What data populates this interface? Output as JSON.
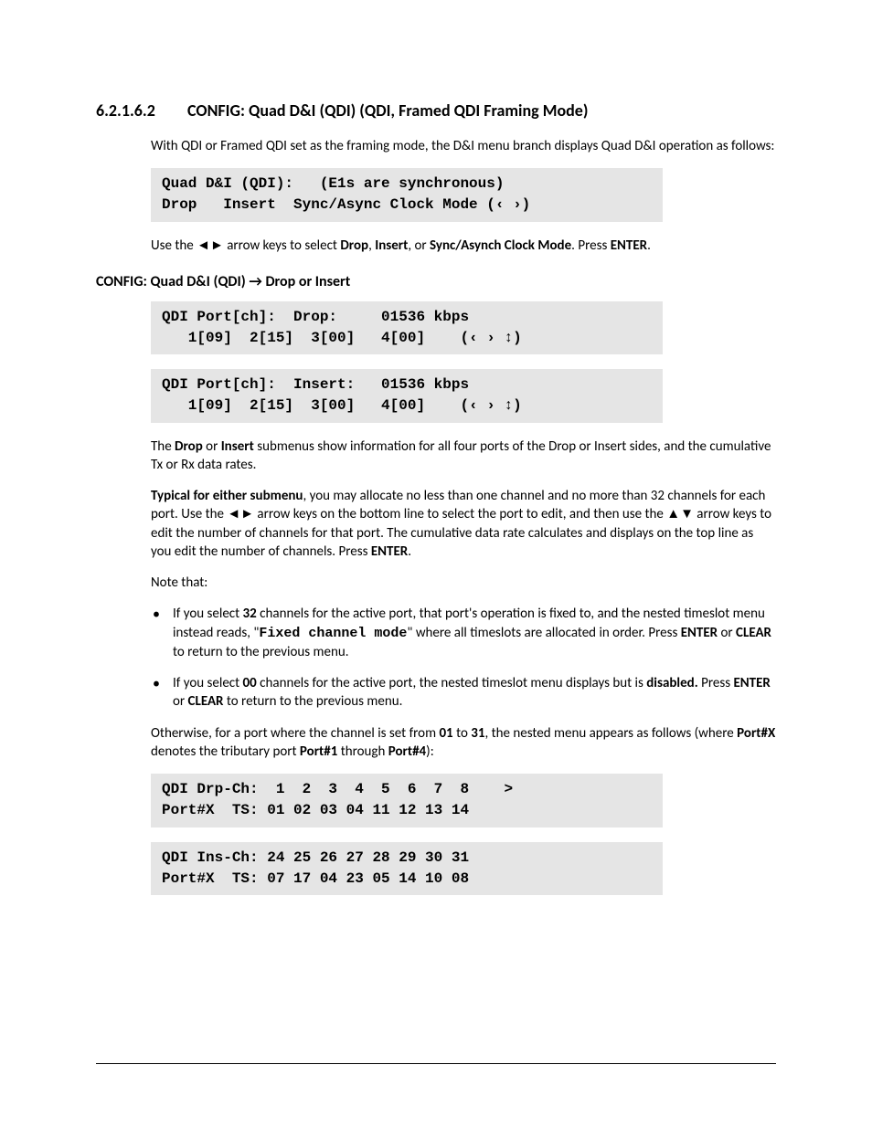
{
  "section": {
    "number": "6.2.1.6.2",
    "title": "CONFIG: Quad D&I (QDI) (QDI, Framed QDI Framing Mode)"
  },
  "paragraphs": {
    "intro": "With QDI or Framed QDI set as the framing mode, the D&I menu branch displays Quad D&I operation as follows:",
    "use_arrows_pre": "Use the ◄► arrow keys to select ",
    "use_arrows_b1": "Drop",
    "use_arrows_mid1": ", ",
    "use_arrows_b2": "Insert",
    "use_arrows_mid2": ", or ",
    "use_arrows_b3": "Sync/Asynch Clock Mode",
    "use_arrows_mid3": ". Press ",
    "use_arrows_b4": "ENTER",
    "use_arrows_end": ".",
    "sub_heading": "CONFIG: Quad D&I (QDI) → Drop or Insert",
    "sub_para_pre": "The ",
    "sub_para_b1": "Drop",
    "sub_para_mid1": " or ",
    "sub_para_b2": "Insert",
    "sub_para_rest": " submenus show information for all four ports of the Drop or Insert sides, and the cumulative Tx or Rx data rates.",
    "typical_b": "Typical for either submenu",
    "typical_rest": ", you may allocate no less than one channel and no more than 32 channels for each port. Use the ◄► arrow keys on the bottom line to select the port to edit, and then use the ▲▼ arrow keys to edit the number of channels for that port. The cumulative data rate calculates and displays on the top line as you edit the number of channels. Press ",
    "typical_b2": "ENTER",
    "typical_end": ".",
    "note_that": "Note that:",
    "bullet1_a": "If you select ",
    "bullet1_b1": "32",
    "bullet1_b": " channels for the active port, that port's operation is fixed to, and the nested timeslot menu instead reads, \"",
    "bullet1_mono": "Fixed channel mode",
    "bullet1_c": "\" where all timeslots are allocated in order. Press ",
    "bullet1_b2": "ENTER",
    "bullet1_d": " or ",
    "bullet1_b3": "CLEAR",
    "bullet1_e": " to return to the previous menu.",
    "bullet2_a": "If you select ",
    "bullet2_b1": "00",
    "bullet2_b": " channels for the active port, the nested timeslot menu displays but is ",
    "bullet2_b2": "disabled.",
    "bullet2_c": " Press ",
    "bullet2_b3": "ENTER",
    "bullet2_d": " or ",
    "bullet2_b4": "CLEAR",
    "bullet2_e": " to return to the previous menu.",
    "otherwise_a": "Otherwise, for a port where the channel is set from ",
    "otherwise_b1": "01",
    "otherwise_b": " to ",
    "otherwise_b2": "31",
    "otherwise_c": ", the nested menu appears as follows (where ",
    "otherwise_b3": "Port#X",
    "otherwise_d": " denotes the tributary port ",
    "otherwise_b4": "Port#1",
    "otherwise_e": " through ",
    "otherwise_b5": "Port#4",
    "otherwise_f": "):"
  },
  "lcd": {
    "screen1_l1": "Quad D&I (QDI):   (E1s are synchronous)",
    "screen1_l2": "Drop   Insert  Sync/Async Clock Mode (‹ ›)",
    "screen2_l1": "QDI Port[ch]:  Drop:     01536 kbps",
    "screen2_l2": "   1[09]  2[15]  3[00]   4[00]    (‹ › ↕)",
    "screen3_l1": "QDI Port[ch]:  Insert:   01536 kbps",
    "screen3_l2": "   1[09]  2[15]  3[00]   4[00]    (‹ › ↕)",
    "screen4_l1": "QDI Drp-Ch:  1  2  3  4  5  6  7  8    >",
    "screen4_l2": "Port#X  TS: 01 02 03 04 11 12 13 14",
    "screen5_l1": "QDI Ins-Ch: 24 25 26 27 28 29 30 31",
    "screen5_l2": "Port#X  TS: 07 17 04 23 05 14 10 08"
  }
}
